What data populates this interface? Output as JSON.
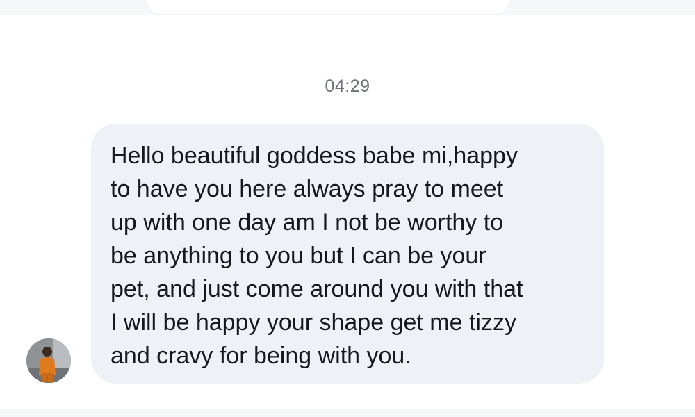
{
  "chat": {
    "timestamp": "04:29",
    "message": {
      "text": "Hello beautiful goddess babe mi,happy\nto have you here always pray to meet\nup with one day am I not be worthy to\nbe anything to you but I can be your\npet, and just come around you with that\nI will be happy your shape get me tizzy\nand cravy for being with you.",
      "direction": "incoming"
    },
    "sender_avatar": "sender-avatar"
  },
  "colors": {
    "bubble_background": "#eef1f5",
    "text": "#16181b",
    "timestamp": "#6d7177",
    "accent_green": "#5bbf63"
  }
}
